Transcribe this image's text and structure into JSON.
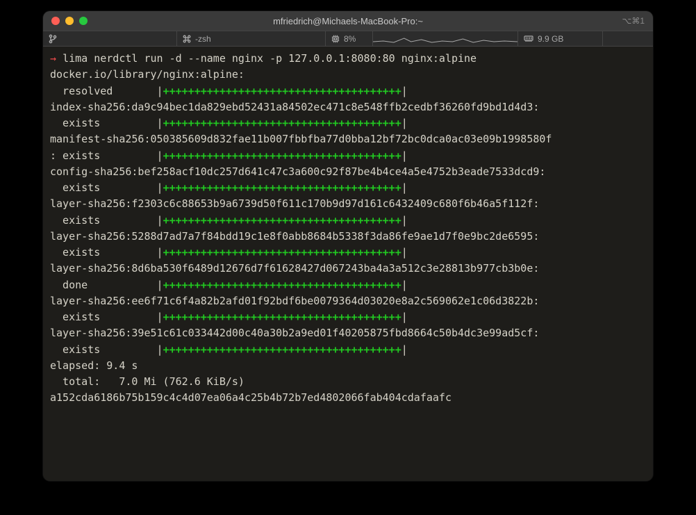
{
  "titlebar": {
    "title": "mfriedrich@Michaels-MacBook-Pro:~",
    "shortcut": "⌥⌘1"
  },
  "statusbar": {
    "branch_icon": "branch",
    "shell_prefix": "⌘",
    "shell": "-zsh",
    "cpu_icon": "cpu",
    "cpu": "8%",
    "mem_icon": "mem",
    "mem": "9.9 GB"
  },
  "prompt": {
    "arrow": "→",
    "command": "lima nerdctl run -d --name nginx -p 127.0.0.1:8080:80 nginx:alpine"
  },
  "lines": [
    "docker.io/library/nginx:alpine:",
    {
      "label": "  resolved       ",
      "bar": "++++++++++++++++++++++++++++++++++++++"
    },
    "index-sha256:da9c94bec1da829ebd52431a84502ec471c8e548ffb2cedbf36260fd9bd1d4d3:",
    {
      "label": "  exists         ",
      "bar": "++++++++++++++++++++++++++++++++++++++"
    },
    "manifest-sha256:050385609d832fae11b007fbbfba77d0bba12bf72bc0dca0ac03e09b1998580f",
    {
      "label": ": exists         ",
      "bar": "++++++++++++++++++++++++++++++++++++++"
    },
    "config-sha256:bef258acf10dc257d641c47c3a600c92f87be4b4ce4a5e4752b3eade7533dcd9:",
    {
      "label": "  exists         ",
      "bar": "++++++++++++++++++++++++++++++++++++++"
    },
    "layer-sha256:f2303c6c88653b9a6739d50f611c170b9d97d161c6432409c680f6b46a5f112f:",
    {
      "label": "  exists         ",
      "bar": "++++++++++++++++++++++++++++++++++++++"
    },
    "layer-sha256:5288d7ad7a7f84bdd19c1e8f0abb8684b5338f3da86fe9ae1d7f0e9bc2de6595:",
    {
      "label": "  exists         ",
      "bar": "++++++++++++++++++++++++++++++++++++++"
    },
    "layer-sha256:8d6ba530f6489d12676d7f61628427d067243ba4a3a512c3e28813b977cb3b0e:",
    {
      "label": "  done           ",
      "bar": "++++++++++++++++++++++++++++++++++++++"
    },
    "layer-sha256:ee6f71c6f4a82b2afd01f92bdf6be0079364d03020e8a2c569062e1c06d3822b:",
    {
      "label": "  exists         ",
      "bar": "++++++++++++++++++++++++++++++++++++++"
    },
    "layer-sha256:39e51c61c033442d00c40a30b2a9ed01f40205875fbd8664c50b4dc3e99ad5cf:",
    {
      "label": "  exists         ",
      "bar": "++++++++++++++++++++++++++++++++++++++"
    },
    "elapsed: 9.4 s",
    "  total:   7.0 Mi (762.6 KiB/s)",
    "a152cda6186b75b159c4c4d07ea06a4c25b4b72b7ed4802066fab404cdafaafc"
  ]
}
